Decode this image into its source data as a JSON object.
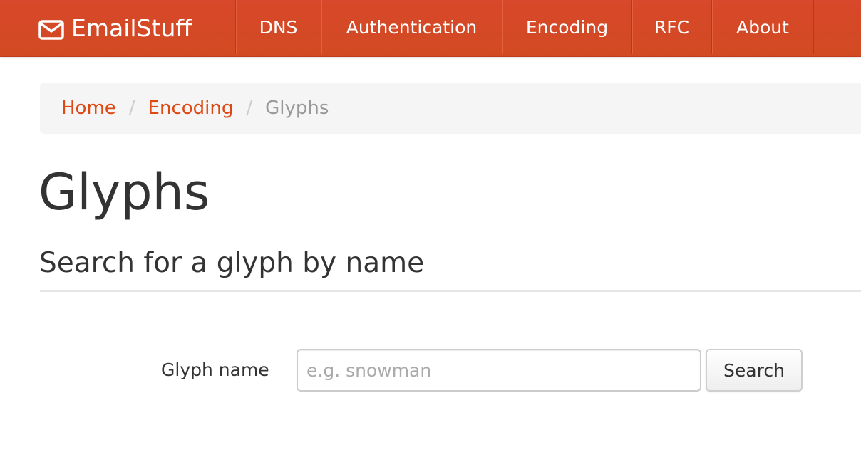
{
  "navbar": {
    "brand": "EmailStuff",
    "brand_icon": "envelope-icon",
    "items": [
      {
        "label": "DNS"
      },
      {
        "label": "Authentication"
      },
      {
        "label": "Encoding"
      },
      {
        "label": "RFC"
      },
      {
        "label": "About"
      }
    ],
    "color": "#d64a24"
  },
  "breadcrumb": {
    "items": [
      {
        "label": "Home"
      },
      {
        "label": "Encoding"
      },
      {
        "label": "Glyphs"
      }
    ],
    "separator": "/",
    "link_color": "#dd4814"
  },
  "page": {
    "title": "Glyphs",
    "section_title": "Search for a glyph by name"
  },
  "form": {
    "label": "Glyph name",
    "input_value": "",
    "input_placeholder": "e.g. snowman",
    "button_label": "Search"
  }
}
